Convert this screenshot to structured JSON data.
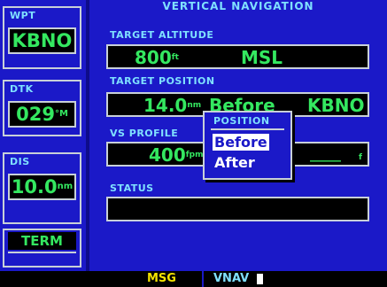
{
  "sidebar": {
    "wpt": {
      "label": "WPT",
      "value": "KBNO"
    },
    "dtk": {
      "label": "DTK",
      "value": "029",
      "unit": "°M"
    },
    "dis": {
      "label": "DIS",
      "value": "10.0",
      "unit": "nm"
    },
    "term": "TERM"
  },
  "main": {
    "title": "VERTICAL NAVIGATION",
    "target_altitude": {
      "label": "TARGET ALTITUDE",
      "value": "800",
      "unit": "ft",
      "ref": "MSL"
    },
    "target_position": {
      "label": "TARGET POSITION",
      "value": "14.0",
      "unit": "nm",
      "relation": "Before",
      "waypoint": "KBNO"
    },
    "vs_profile": {
      "label": "VS PROFILE",
      "value": "400",
      "unit": "fpm",
      "right_value": "_____",
      "right_unit": "f"
    },
    "status": {
      "label": "STATUS",
      "value": ""
    }
  },
  "popup": {
    "title": "POSITION",
    "options": [
      "Before",
      "After"
    ],
    "selected": "Before"
  },
  "statusbar": {
    "msg": "MSG",
    "mode": "VNAV"
  },
  "colors": {
    "background": "#1b19c8",
    "value_green": "#34e860",
    "label_cyan": "#7fe0ff",
    "msg_yellow": "#f2e200"
  }
}
